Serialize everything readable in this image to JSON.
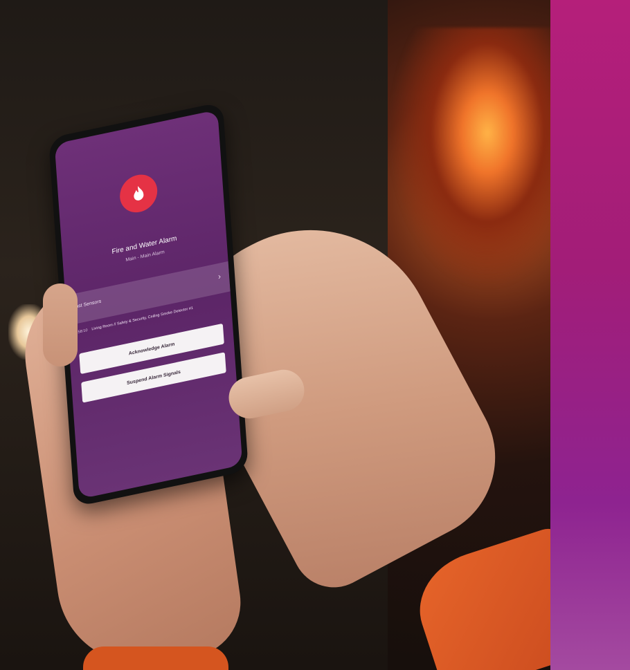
{
  "scene": {
    "description_icon": "fire-icon",
    "accent_colors": {
      "alarm_red": "#e53245",
      "screen_purple": "#5c2567",
      "brand_magenta": "#b51f7a"
    }
  },
  "app": {
    "alarm_title": "Fire and Water Alarm",
    "alarm_subtitle": "Main - Main Alarm",
    "last_sensors_label": "Last Sensors",
    "sensor_time": "8:58:10",
    "sensor_detail": "Living Room // Safety & Security, Ceiling Smoke Detector #1",
    "acknowledge_label": "Acknowledge Alarm",
    "suspend_label": "Suspend Alarm Signals"
  }
}
